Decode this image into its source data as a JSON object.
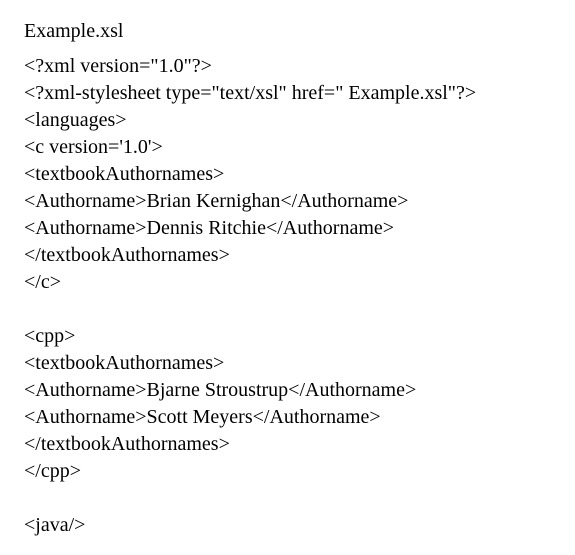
{
  "title": "Example.xsl",
  "lines_block1": [
    "<?xml version=\"1.0\"?>",
    "<?xml-stylesheet type=\"text/xsl\" href=\" Example.xsl\"?>",
    "<languages>",
    "<c version='1.0'>",
    "<textbookAuthornames>",
    "<Authorname>Brian Kernighan</Authorname>",
    "<Authorname>Dennis Ritchie</Authorname>",
    "</textbookAuthornames>",
    "</c>"
  ],
  "lines_block2": [
    "<cpp>",
    "<textbookAuthornames>",
    "<Authorname>Bjarne Stroustrup</Authorname>",
    "<Authorname>Scott Meyers</Authorname>",
    "</textbookAuthornames>",
    "</cpp>"
  ],
  "lines_block3": [
    "<java/>"
  ]
}
